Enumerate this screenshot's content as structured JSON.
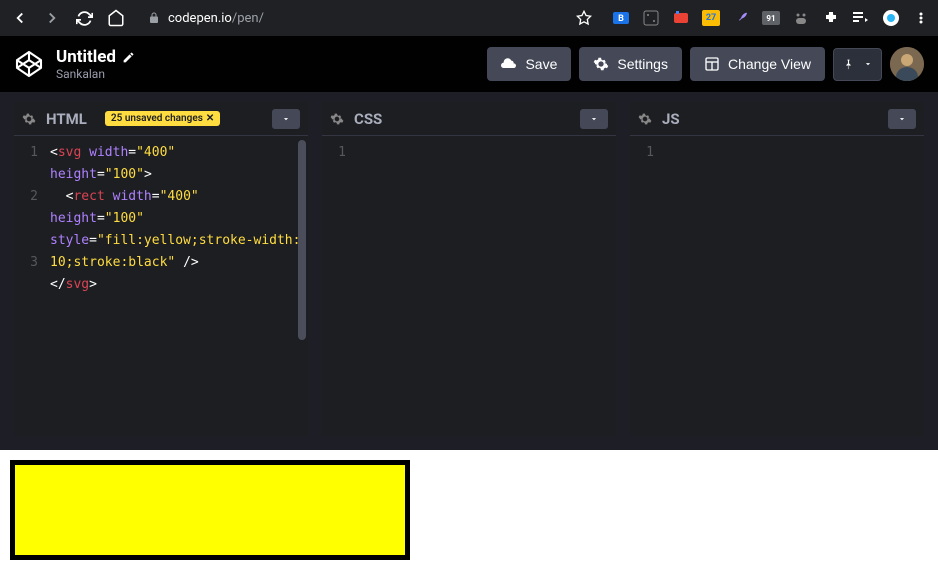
{
  "browser": {
    "url_domain": "codepen.io",
    "url_path": "/pen/",
    "ext_calendar_badge": "27",
    "ext_camera_badge": "91"
  },
  "header": {
    "title": "Untitled",
    "author": "Sankalan",
    "save_label": "Save",
    "settings_label": "Settings",
    "change_view_label": "Change View"
  },
  "panels": {
    "html": {
      "label": "HTML",
      "unsaved_badge": "25 unsaved changes",
      "lines": [
        "1",
        "",
        "2",
        "",
        "",
        "3"
      ],
      "code_tokens": [
        [
          {
            "t": "op",
            "v": "<"
          },
          {
            "t": "tag",
            "v": "svg"
          },
          {
            "t": "plain",
            "v": " "
          },
          {
            "t": "attr",
            "v": "width"
          },
          {
            "t": "op",
            "v": "="
          },
          {
            "t": "str",
            "v": "\"400\""
          }
        ],
        [
          {
            "t": "attr",
            "v": "height"
          },
          {
            "t": "op",
            "v": "="
          },
          {
            "t": "str",
            "v": "\"100\""
          },
          {
            "t": "op",
            "v": ">"
          }
        ],
        [
          {
            "t": "plain",
            "v": "  "
          },
          {
            "t": "op",
            "v": "<"
          },
          {
            "t": "tag",
            "v": "rect"
          },
          {
            "t": "plain",
            "v": " "
          },
          {
            "t": "attr",
            "v": "width"
          },
          {
            "t": "op",
            "v": "="
          },
          {
            "t": "str",
            "v": "\"400\""
          }
        ],
        [
          {
            "t": "attr",
            "v": "height"
          },
          {
            "t": "op",
            "v": "="
          },
          {
            "t": "str",
            "v": "\"100\""
          }
        ],
        [
          {
            "t": "attr",
            "v": "style"
          },
          {
            "t": "op",
            "v": "="
          },
          {
            "t": "str",
            "v": "\"fill:yellow;stroke-width:10;stroke:black\""
          },
          {
            "t": "plain",
            "v": " "
          },
          {
            "t": "op",
            "v": "/>"
          }
        ],
        [
          {
            "t": "op",
            "v": "</"
          },
          {
            "t": "tag",
            "v": "svg"
          },
          {
            "t": "op",
            "v": ">"
          }
        ]
      ]
    },
    "css": {
      "label": "CSS",
      "line1": "1"
    },
    "js": {
      "label": "JS",
      "line1": "1"
    }
  },
  "output": {
    "rect_fill": "yellow",
    "rect_stroke": "black",
    "rect_stroke_width": "10",
    "svg_width": "400",
    "svg_height": "100"
  }
}
